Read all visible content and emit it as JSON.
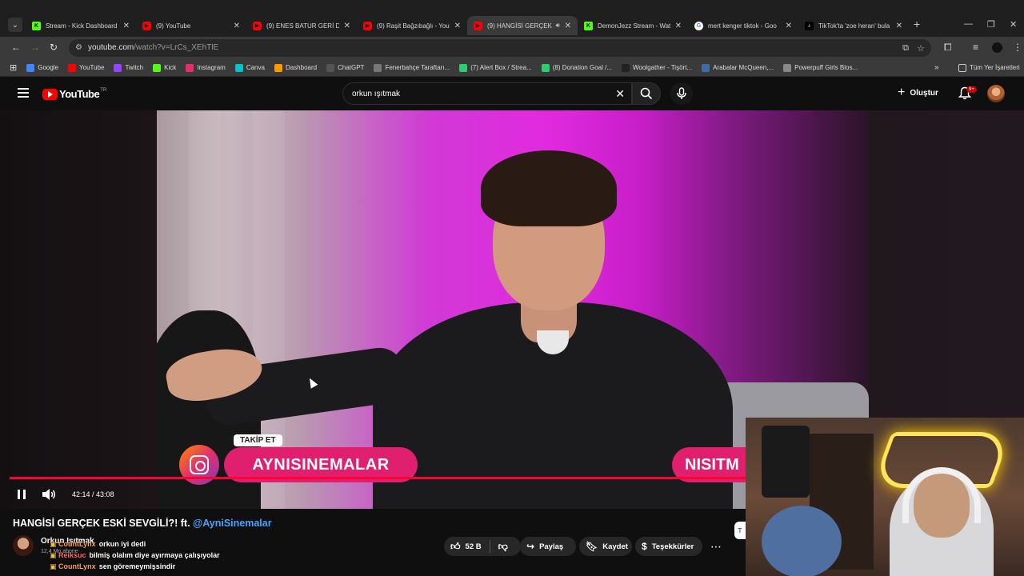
{
  "browser": {
    "tabs": [
      {
        "title": "Stream - Kick Dashboard",
        "favicon": "kick-icon",
        "active": false
      },
      {
        "title": "(9) YouTube",
        "favicon": "youtube-icon",
        "active": false
      },
      {
        "title": "(9) ENES BATUR GERİ DÖN",
        "favicon": "youtube-icon",
        "active": false
      },
      {
        "title": "(9) Raşit Bağzıbağlı - YouT",
        "favicon": "youtube-icon",
        "active": false
      },
      {
        "title": "(9) HANGİSİ GERÇEK",
        "favicon": "youtube-icon",
        "active": true
      },
      {
        "title": "DemonJezz Stream - Wat",
        "favicon": "kick-icon",
        "active": false
      },
      {
        "title": "mert kenger tiktok - Goo",
        "favicon": "google-icon",
        "active": false
      },
      {
        "title": "TikTok'ta 'zoe heran' bula",
        "favicon": "tiktok-icon",
        "active": false
      }
    ],
    "url_host": "youtube.com",
    "url_path": "/watch?v=LrCs_XEhTlE",
    "bookmarks": [
      {
        "label": "Google",
        "color": "#4285f4"
      },
      {
        "label": "YouTube",
        "color": "#ff0000"
      },
      {
        "label": "Twitch",
        "color": "#9146ff"
      },
      {
        "label": "Kick",
        "color": "#53fc18"
      },
      {
        "label": "Instagram",
        "color": "#e1306c"
      },
      {
        "label": "Canva",
        "color": "#00c4cc"
      },
      {
        "label": "Dashboard",
        "color": "#ff9900"
      },
      {
        "label": "ChatGPT",
        "color": "#555555"
      },
      {
        "label": "Fenerbahçe Taraftarı...",
        "color": "#777777"
      },
      {
        "label": "(7) Alert Box / Strea...",
        "color": "#2ecc71"
      },
      {
        "label": "(8) Donation Goal /...",
        "color": "#2ecc71"
      },
      {
        "label": "Woolgather - Tişört...",
        "color": "#222222"
      },
      {
        "label": "Arabalar McQueen,...",
        "color": "#3a6ea5"
      },
      {
        "label": "Powerpuff Girls Blos...",
        "color": "#888888"
      }
    ],
    "all_bookmarks": "Tüm Yer İşaretleri"
  },
  "youtube": {
    "logo_text": "YouTube",
    "region": "TR",
    "search_query": "orkun ışıtmak",
    "create_label": "Oluştur",
    "notif_count": "9+"
  },
  "video": {
    "overlay_follow": "TAKİP ET",
    "overlay_handle": "AYNISINEMALAR",
    "overlay_partial": "NISITM",
    "time_current": "42:14",
    "time_sep": " / ",
    "time_total": "43:08",
    "progress": 0.979,
    "title_main": "HANGİSİ GERÇEK ESKİ SEVGİLİ?! ft. ",
    "title_mention": "@AyniSinemalar",
    "channel_name": "Orkun Işıtmak",
    "subscribers": "12,4 Mn abone",
    "likes": "52 B",
    "share_label": "Paylaş",
    "save_label": "Kaydet",
    "thanks_label": "Teşekkürler"
  },
  "chat": [
    {
      "user": "CountLynx",
      "message": "orkun iyi dedi"
    },
    {
      "user": "Reiksuc",
      "message": "bilmiş olalım diye ayırmaya çalışıyolar"
    },
    {
      "user": "CountLynx",
      "message": "sen göremeymişsindir"
    }
  ]
}
